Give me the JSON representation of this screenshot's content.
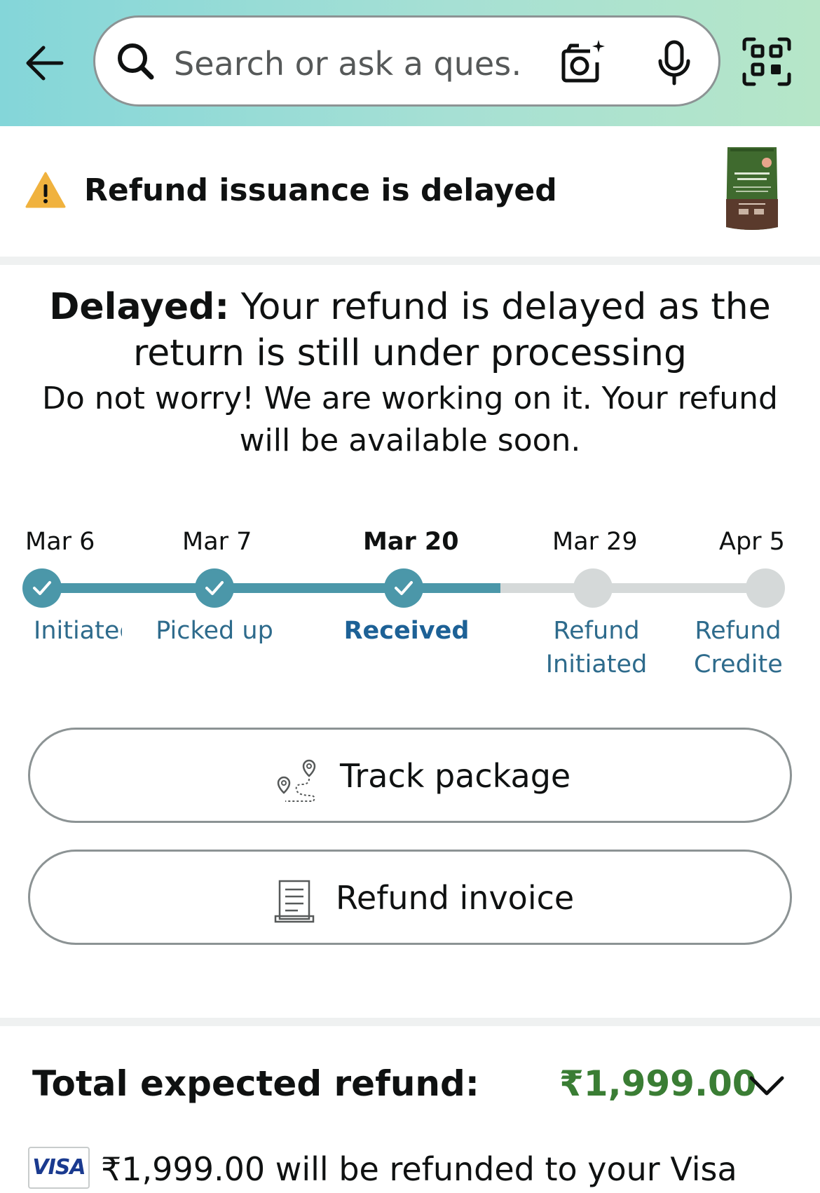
{
  "header": {
    "search_placeholder": "Search or ask a ques…"
  },
  "alert": {
    "title": "Refund issuance is delayed",
    "icon": "warning-icon"
  },
  "delay_message": {
    "bold_prefix": "Delayed:",
    "text": " Your refund is delayed as the return is still under processing",
    "subtext": "Do not worry! We are working on it. Your refund will be available soon."
  },
  "timeline": {
    "steps": [
      {
        "date": "Mar 6",
        "label": "Initiated",
        "done": true,
        "current": false
      },
      {
        "date": "Mar 7",
        "label": "Picked up",
        "done": true,
        "current": false
      },
      {
        "date": "Mar 20",
        "label": "Received",
        "done": true,
        "current": true
      },
      {
        "date": "Mar 29",
        "label": "Refund Initiated",
        "done": false,
        "current": false
      },
      {
        "date": "Apr 5",
        "label": "Refund Credited",
        "done": false,
        "current": false
      }
    ],
    "colors": {
      "done": "#4b97a9",
      "pending": "#d5d9d9",
      "label": "#2e6b8c"
    }
  },
  "buttons": {
    "track_package": "Track package",
    "refund_invoice": "Refund invoice"
  },
  "refund": {
    "total_label": "Total expected refund:",
    "total_amount": "₹1,999.00",
    "card_brand": "VISA",
    "line": "₹1,999.00 will be refunded to your Visa"
  }
}
